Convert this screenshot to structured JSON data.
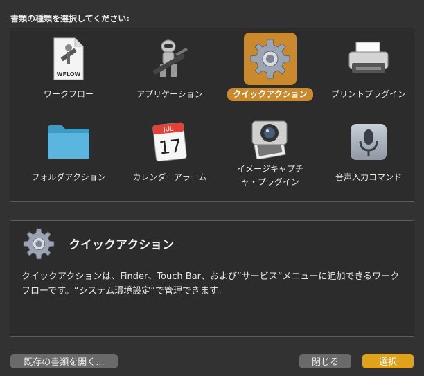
{
  "prompt": "書類の種類を選択してください:",
  "tiles": [
    {
      "label": "ワークフロー",
      "icon": "workflow-document-icon",
      "badge": "WFLOW"
    },
    {
      "label": "アプリケーション",
      "icon": "automator-robot-icon"
    },
    {
      "label": "クイックアクション",
      "icon": "gear-icon"
    },
    {
      "label": "プリントプラグイン",
      "icon": "printer-icon"
    },
    {
      "label": "フォルダアクション",
      "icon": "folder-icon"
    },
    {
      "label": "カレンダーアラーム",
      "icon": "calendar-icon",
      "month": "JUL",
      "day": "17"
    },
    {
      "label": "イメージキャプチ",
      "label2": "ャ・プラグイン",
      "icon": "camera-icon"
    },
    {
      "label": "音声入力コマンド",
      "icon": "microphone-icon"
    }
  ],
  "selected_index": 2,
  "description": {
    "title": "クイックアクション",
    "body": "クイックアクションは、Finder、Touch Bar、および“サービス”メニューに追加できるワークフローです。“システム環境設定”で管理できます。"
  },
  "buttons": {
    "open_existing": "既存の書類を開く...",
    "close": "閉じる",
    "choose": "選択"
  },
  "colors": {
    "background": "#323232",
    "selection": "#c9892c",
    "primary_button": "#e0a21a"
  }
}
